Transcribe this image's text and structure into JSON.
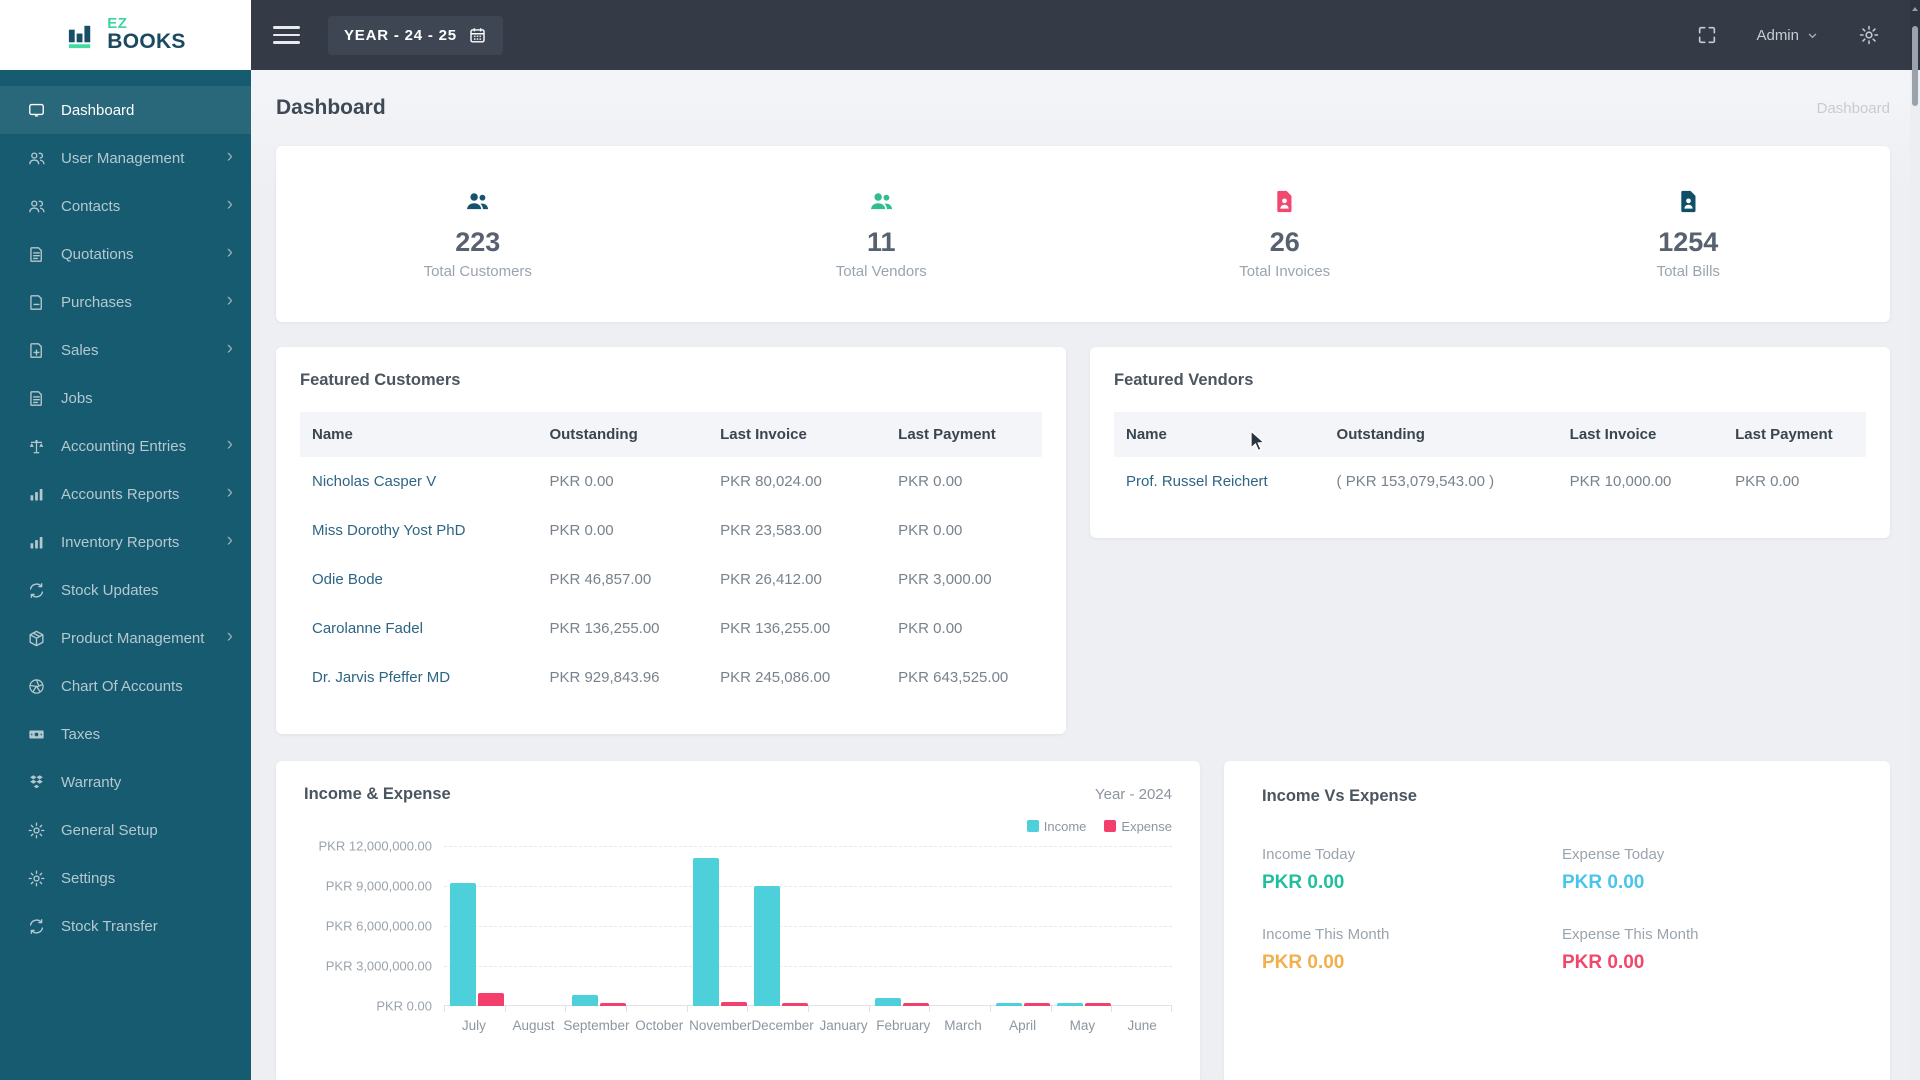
{
  "brand": {
    "name_line1": "EZ",
    "name_line2": "BOOKS"
  },
  "topbar": {
    "year_selector": "YEAR - 24 - 25",
    "admin_label": "Admin"
  },
  "page": {
    "title": "Dashboard",
    "breadcrumb": "Dashboard"
  },
  "sidebar": {
    "items": [
      {
        "label": "Dashboard",
        "icon": "dashboard-screen-icon",
        "active": true,
        "has_children": false
      },
      {
        "label": "User Management",
        "icon": "users-icon",
        "active": false,
        "has_children": true
      },
      {
        "label": "Contacts",
        "icon": "users-icon",
        "active": false,
        "has_children": true
      },
      {
        "label": "Quotations",
        "icon": "document-icon",
        "active": false,
        "has_children": true
      },
      {
        "label": "Purchases",
        "icon": "document-minus-icon",
        "active": false,
        "has_children": true
      },
      {
        "label": "Sales",
        "icon": "document-plus-icon",
        "active": false,
        "has_children": true
      },
      {
        "label": "Jobs",
        "icon": "document-icon",
        "active": false,
        "has_children": false
      },
      {
        "label": "Accounting Entries",
        "icon": "balance-scale-icon",
        "active": false,
        "has_children": true
      },
      {
        "label": "Accounts Reports",
        "icon": "bar-chart-icon",
        "active": false,
        "has_children": true
      },
      {
        "label": "Inventory Reports",
        "icon": "bar-chart-icon",
        "active": false,
        "has_children": true
      },
      {
        "label": "Stock Updates",
        "icon": "sync-arrows-icon",
        "active": false,
        "has_children": false
      },
      {
        "label": "Product Management",
        "icon": "package-icon",
        "active": false,
        "has_children": true
      },
      {
        "label": "Chart Of Accounts",
        "icon": "aperture-icon",
        "active": false,
        "has_children": false
      },
      {
        "label": "Taxes",
        "icon": "money-bill-icon",
        "active": false,
        "has_children": false
      },
      {
        "label": "Warranty",
        "icon": "dropbox-icon",
        "active": false,
        "has_children": false
      },
      {
        "label": "General Setup",
        "icon": "gear-icon",
        "active": false,
        "has_children": false
      },
      {
        "label": "Settings",
        "icon": "gear-icon",
        "active": false,
        "has_children": false
      },
      {
        "label": "Stock Transfer",
        "icon": "sync-arrows-icon",
        "active": false,
        "has_children": false
      }
    ]
  },
  "stats": [
    {
      "value": "223",
      "label": "Total Customers",
      "icon": "people-icon",
      "color": "#14546d"
    },
    {
      "value": "11",
      "label": "Total Vendors",
      "icon": "people-icon",
      "color": "#2fbe8f"
    },
    {
      "value": "26",
      "label": "Total Invoices",
      "icon": "invoice-file-icon",
      "color": "#f2486f"
    },
    {
      "value": "1254",
      "label": "Total Bills",
      "icon": "bill-file-icon",
      "color": "#0f4f67"
    }
  ],
  "featured_customers": {
    "title": "Featured Customers",
    "columns": [
      "Name",
      "Outstanding",
      "Last Invoice",
      "Last Payment"
    ],
    "rows": [
      {
        "name": "Nicholas Casper V",
        "outstanding": "PKR 0.00",
        "last_invoice": "PKR 80,024.00",
        "last_payment": "PKR 0.00"
      },
      {
        "name": "Miss Dorothy Yost PhD",
        "outstanding": "PKR 0.00",
        "last_invoice": "PKR 23,583.00",
        "last_payment": "PKR 0.00"
      },
      {
        "name": "Odie Bode",
        "outstanding": "PKR 46,857.00",
        "last_invoice": "PKR 26,412.00",
        "last_payment": "PKR 3,000.00"
      },
      {
        "name": "Carolanne Fadel",
        "outstanding": "PKR 136,255.00",
        "last_invoice": "PKR 136,255.00",
        "last_payment": "PKR 0.00"
      },
      {
        "name": "Dr. Jarvis Pfeffer MD",
        "outstanding": "PKR 929,843.96",
        "last_invoice": "PKR 245,086.00",
        "last_payment": "PKR 643,525.00"
      }
    ]
  },
  "featured_vendors": {
    "title": "Featured Vendors",
    "columns": [
      "Name",
      "Outstanding",
      "Last Invoice",
      "Last Payment"
    ],
    "rows": [
      {
        "name": "Prof. Russel Reichert",
        "outstanding": "( PKR 153,079,543.00 )",
        "last_invoice": "PKR 10,000.00",
        "last_payment": "PKR 0.00"
      }
    ]
  },
  "chart_data": {
    "type": "bar",
    "title": "Income & Expense",
    "period_label": "Year - 2024",
    "categories": [
      "July",
      "August",
      "September",
      "October",
      "November",
      "December",
      "January",
      "February",
      "March",
      "April",
      "May",
      "June"
    ],
    "series": [
      {
        "name": "Income",
        "color": "#4dd0d9",
        "values": [
          9200000,
          0,
          850000,
          0,
          11100000,
          9000000,
          0,
          600000,
          0,
          120000,
          120000,
          0
        ]
      },
      {
        "name": "Expense",
        "color": "#f43f6d",
        "values": [
          1000000,
          0,
          150000,
          0,
          300000,
          250000,
          0,
          150000,
          0,
          150000,
          150000,
          0
        ]
      }
    ],
    "y_ticks": [
      "PKR 12,000,000.00",
      "PKR 9,000,000.00",
      "PKR 6,000,000.00",
      "PKR 3,000,000.00",
      "PKR 0.00"
    ],
    "ylim": [
      0,
      12000000
    ],
    "grid": "dashed-horizontal",
    "legend_position": "top-right"
  },
  "income_vs_expense": {
    "title": "Income Vs Expense",
    "items": [
      {
        "label": "Income Today",
        "value": "PKR 0.00",
        "color": "#21bf9b"
      },
      {
        "label": "Expense Today",
        "value": "PKR 0.00",
        "color": "#4bc4ec"
      },
      {
        "label": "Income This Month",
        "value": "PKR 0.00",
        "color": "#f3ae4d"
      },
      {
        "label": "Expense This Month",
        "value": "PKR 0.00",
        "color": "#f1476b"
      }
    ]
  }
}
